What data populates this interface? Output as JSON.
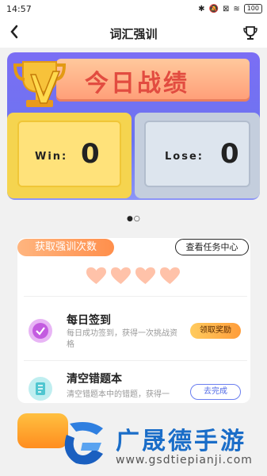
{
  "status_bar": {
    "time": "14:57",
    "battery": "100"
  },
  "header": {
    "title": "词汇强训"
  },
  "record": {
    "banner_title": "今日战绩",
    "win_label": "Win:",
    "win_value": "0",
    "lose_label": "Lose:",
    "lose_value": "0"
  },
  "pagination": {
    "dots": "●○"
  },
  "tasks_section": {
    "tag": "获取强训次数",
    "center_button": "查看任务中心",
    "hearts_count": 4,
    "items": [
      {
        "icon": "checkin-icon",
        "title": "每日签到",
        "desc": "每日成功签到，获得一次挑战资格",
        "button": "领取奖励"
      },
      {
        "icon": "notebook-icon",
        "title": "清空错题本",
        "desc": "清空错题本中的错题，获得一",
        "button": "去完成"
      }
    ]
  },
  "watermark": {
    "title": "广晟德手游",
    "url": "www.gsdtiepianji.com"
  },
  "colors": {
    "accent_purple": "#7b6ef4",
    "orange": "#ff8f4c",
    "win_yellow": "#f5d44f",
    "lose_gray": "#c4cedd"
  }
}
